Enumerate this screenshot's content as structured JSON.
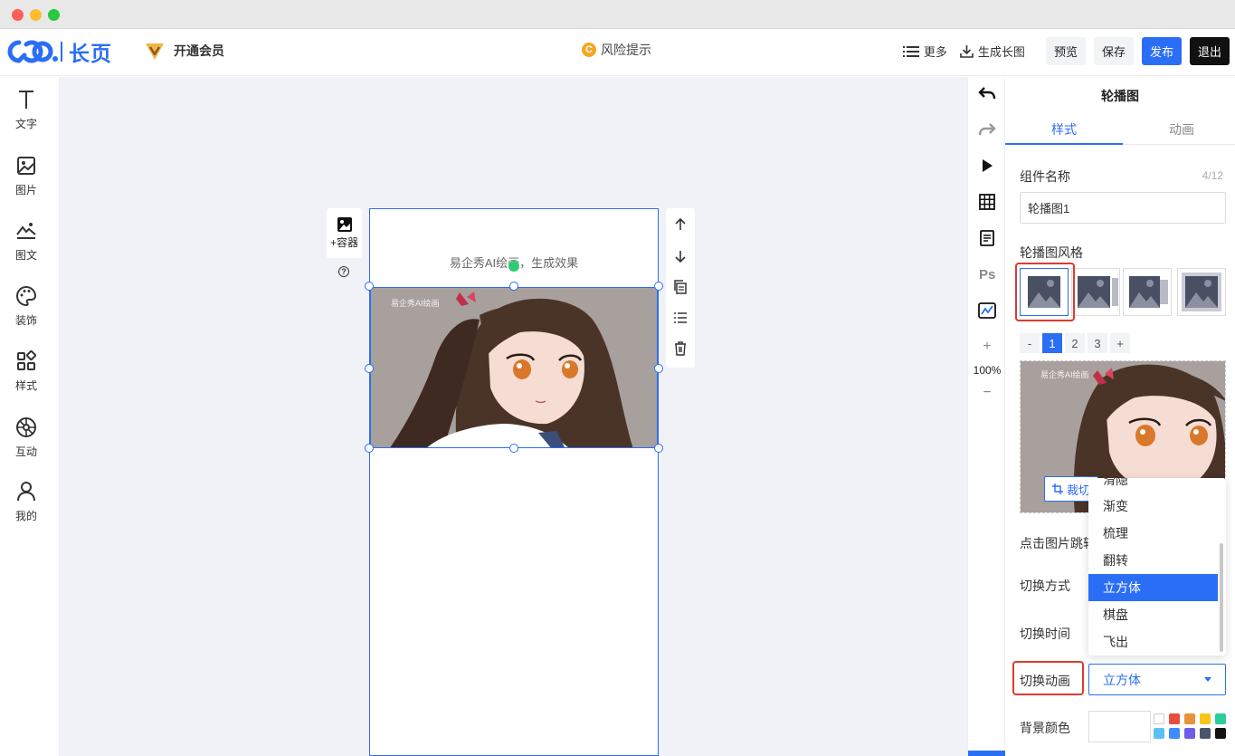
{
  "header": {
    "logo_text": "长页",
    "vip_label": "开通会员",
    "risk_label": "风险提示",
    "risk_icon_char": "C",
    "more_label": "更多",
    "long_image_label": "生成长图",
    "preview_label": "预览",
    "save_label": "保存",
    "publish_label": "发布",
    "exit_label": "退出"
  },
  "sidebar": {
    "items": [
      {
        "label": "文字",
        "icon": "text-icon"
      },
      {
        "label": "图片",
        "icon": "image-icon"
      },
      {
        "label": "图文",
        "icon": "image-text-icon"
      },
      {
        "label": "装饰",
        "icon": "palette-icon"
      },
      {
        "label": "样式",
        "icon": "styles-icon"
      },
      {
        "label": "互动",
        "icon": "interaction-icon"
      },
      {
        "label": "我的",
        "icon": "user-icon"
      }
    ]
  },
  "canvas": {
    "container_label": "+容器",
    "help_char": "?",
    "caption": "易企秀AI绘画，生成效果",
    "watermark": "易企秀AI绘画"
  },
  "toolcol": {
    "zoom": "100%",
    "plus": "+",
    "minus": "−"
  },
  "panel": {
    "title": "轮播图",
    "tabs": [
      "样式",
      "动画"
    ],
    "component_name_label": "组件名称",
    "component_name_value": "轮播图1",
    "component_name_counter": "4/12",
    "style_label": "轮播图风格",
    "pager": [
      "-",
      "1",
      "2",
      "3",
      "+"
    ],
    "crop_label": "裁切",
    "click_jump_label": "点击图片跳转",
    "switch_mode_label": "切换方式",
    "switch_time_label": "切换时间",
    "switch_anim_label": "切换动画",
    "switch_anim_value": "立方体",
    "bg_color_label": "背景颜色",
    "colors": [
      "#ffffff",
      "#e74c3c",
      "#e8913a",
      "#f5c518",
      "#2ecc9a",
      "#5bc0f8",
      "#3d8bfd",
      "#6c5ce7",
      "#4a5568",
      "#111111"
    ]
  },
  "dropdown": {
    "partial_item": "滑隐",
    "items": [
      "渐变",
      "梳理",
      "翻转",
      "立方体",
      "棋盘",
      "飞出"
    ],
    "selected": "立方体"
  }
}
